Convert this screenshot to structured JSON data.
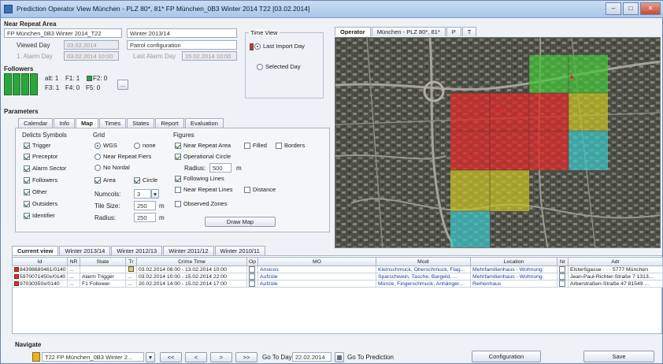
{
  "window": {
    "title": "Prediction Operator View München - PLZ 80*, 81* FP München_0B3 Winter 2014 T22 [03.02.2014]",
    "buttons": {
      "minimize": "–",
      "maximize": "□",
      "close": "✕"
    }
  },
  "near_repeat": {
    "heading": "Near Repeat Area",
    "area_value": "FP München_0B3 Winter 2014_T22",
    "season_value": "Winter 2013/14",
    "viewed_day_label": "Viewed Day",
    "viewed_day_value": "03.02.2014",
    "patrol_value": "Patrol configuration",
    "alarm_day_label": "1. Alarm Day",
    "alarm_day_value": "03.02.2014 10:00",
    "last_alarm_label": "Last Alarm Day",
    "last_alarm_value": "15.02.2014 10:00"
  },
  "followers": {
    "heading": "Followers",
    "counts": [
      {
        "label": "alt:",
        "value": "1"
      },
      {
        "label": "F1:",
        "value": "1"
      },
      {
        "label": "F2:",
        "value": "0"
      },
      {
        "label": "F3:",
        "value": "1"
      },
      {
        "label": "F4:",
        "value": "0"
      },
      {
        "label": "F5:",
        "value": "0"
      }
    ],
    "more_button": "..."
  },
  "time_view": {
    "heading": "Time View",
    "option_last": "Last Import Day",
    "option_selected": "Selected Day"
  },
  "parameters": {
    "heading": "Parameters",
    "tabs": [
      "Calendar",
      "Info",
      "Map",
      "Times",
      "States",
      "Report",
      "Evaluation"
    ],
    "active_tab": "Map",
    "delicts": {
      "heading": "Delicts Symbols",
      "items": [
        {
          "label": "Trigger",
          "checked": true
        },
        {
          "label": "Preceptor",
          "checked": true
        },
        {
          "label": "Alarm Sector",
          "checked": true
        },
        {
          "label": "Followers",
          "checked": true
        },
        {
          "label": "Other",
          "checked": true
        },
        {
          "label": "Outsiders",
          "checked": true
        },
        {
          "label": "Identifier",
          "checked": true
        }
      ]
    },
    "grid": {
      "heading": "Grid",
      "opt_wgs": "WGS",
      "opt_none": "none",
      "opt_near": "Near Repeat Fiers",
      "opt_noscale": "No Nordal",
      "area_label": "Area",
      "circle_label": "Circle",
      "numcols_label": "Numcols:",
      "numcols_value": "3",
      "tilesize_label": "Tile Size:",
      "tilesize_value": "250",
      "radius_label": "Radius:",
      "radius_value": "250",
      "unit": "m"
    },
    "figures": {
      "heading": "Figures",
      "near_repeat_area": "Near Repeat Area",
      "filled": "Filled",
      "borders": "Borders",
      "operational_circle": "Operational Circle",
      "radius_label": "Radius:",
      "radius_value": "500",
      "unit": "m",
      "following_lines": "Following Lines",
      "near_repeat_lines": "Near Repeat Lines",
      "distance": "Distance",
      "observed_zones": "Observed Zones",
      "draw_button": "Draw Map"
    }
  },
  "map_tabs": [
    "Operator",
    "München - PLZ 80*, 81*",
    "P",
    "T"
  ],
  "bottom_tabs": [
    "Current view",
    "Winter 2013/14",
    "Winter 2012/13",
    "Winter 2011/12",
    "Winter 2010/11"
  ],
  "table": {
    "headers": [
      "Id",
      "NR",
      "State",
      "Tr",
      "Crime Time",
      "Op",
      "MO",
      "Modi",
      "Location",
      "Nr",
      "Adr"
    ],
    "rows": [
      {
        "id": "84398680461/0140",
        "nr": "...",
        "state": "",
        "tr": "",
        "time": "03.02.2014 08:00 - 13.02.2014 10:00",
        "op": "",
        "mo": "Ansicos",
        "modi": "Kleinschmuck, Oberschmuck, Flag...",
        "location": "Mehrfamilienhaus - Wohnung",
        "nr2": "",
        "adr": "Elsterßgasse · · · 5777 München"
      },
      {
        "id": "5970071450x/0140",
        "nr": "...",
        "state": "Alarm Trigger",
        "tr": "...",
        "time": "03.02.2014 10:00 - 15.02.2014 22:00",
        "op": "",
        "mo": "Aufzüle",
        "modi": "Sparschwein, Tasche, Bargeld, ...",
        "location": "Mehrfamilienhaus - Wohnung",
        "nr2": "",
        "adr": "Jean-Paul-Richter-Straße 7 1313..."
      },
      {
        "id": "97030350x/0140",
        "nr": "...",
        "state": "F1 Follower",
        "tr": "...",
        "time": "20.02.2014 14:00 - 15.02.2014 17:00",
        "op": "",
        "mo": "Aufzüle",
        "modi": "Münze, Fingerschmuck, Anhänger...",
        "location": "Reihenhaus",
        "nr2": "",
        "adr": "Arberstraßen-Straße 47 81549 ..."
      }
    ]
  },
  "bottom_bar": {
    "heading": "Navigate",
    "selector_value": "T22 FP München_0B3 Winter 2...",
    "nav_first": "<<",
    "nav_prev": "<",
    "nav_next": ">",
    "nav_last": ">>",
    "go_to_day_label": "Go To Day",
    "go_to_day_value": "22.02.2014",
    "go_to_prediction": "Go To Prediction",
    "configuration_button": "Configuration",
    "save_button": "Save"
  },
  "colors": {
    "red_zone": "#e32a2a",
    "green_zone": "#46c63a",
    "yellow_zone": "#c8c226",
    "cyan_zone": "#3ec7c9"
  }
}
